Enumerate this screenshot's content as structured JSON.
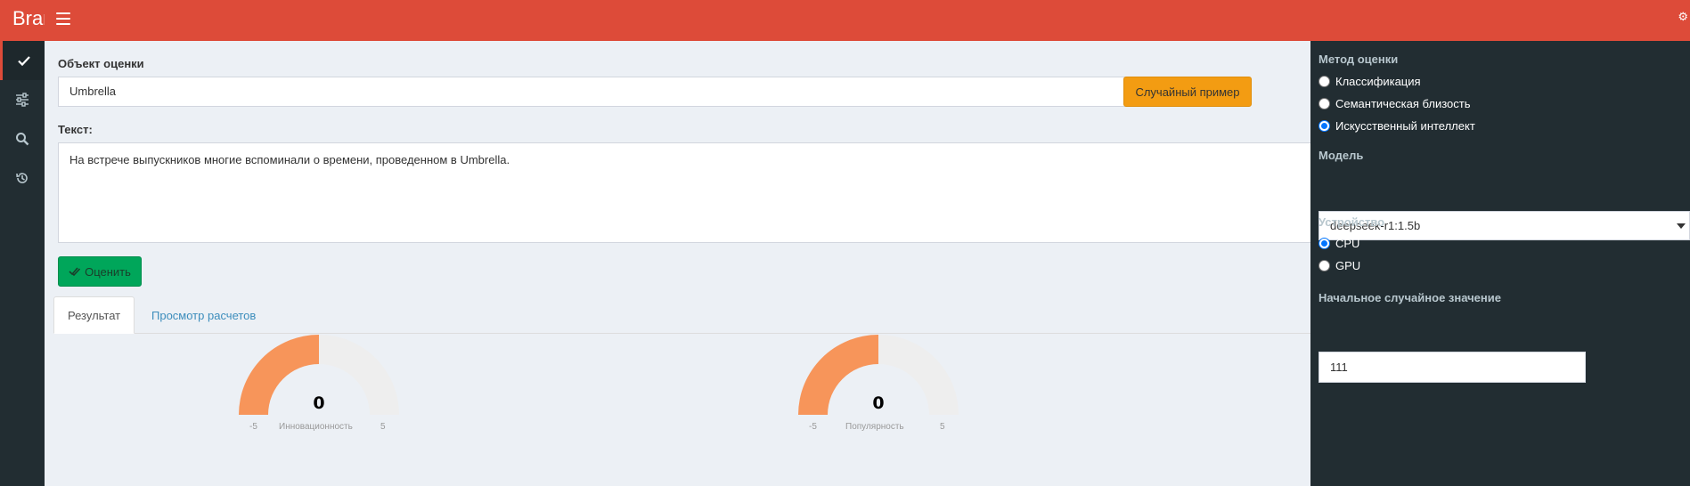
{
  "header": {
    "brand": "Brand",
    "menu_icon": "hamburger-icon",
    "settings_icon": "gear-icon"
  },
  "left_sidebar": {
    "items": [
      {
        "icon": "check-icon",
        "active": true
      },
      {
        "icon": "sliders-icon",
        "active": false
      },
      {
        "icon": "search-icon",
        "active": false
      },
      {
        "icon": "history-icon",
        "active": false
      }
    ]
  },
  "form": {
    "object_label": "Объект оценки",
    "object_value": "Umbrella",
    "random_button": "Случайный пример",
    "text_label": "Текст:",
    "text_value": "На встрече выпускников многие вспоминали о времени, проведенном в Umbrella.",
    "evaluate_button": "Оценить"
  },
  "tabs": [
    {
      "label": "Результат",
      "active": true
    },
    {
      "label": "Просмотр расчетов",
      "active": false
    }
  ],
  "gauges": [
    {
      "value": "0",
      "min": "-5",
      "max": "5",
      "name": "Инновационность",
      "level": 0
    },
    {
      "value": "0",
      "min": "-5",
      "max": "5",
      "name": "Популярность",
      "level": 0
    }
  ],
  "right_panel": {
    "method_label": "Метод оценки",
    "methods": [
      {
        "label": "Классификация",
        "checked": false
      },
      {
        "label": "Семантическая близость",
        "checked": false
      },
      {
        "label": "Искусственный интеллект",
        "checked": true
      }
    ],
    "model_label": "Модель",
    "model_value": "deepseek-r1:1.5b",
    "device_label": "Устройство",
    "devices": [
      {
        "label": "CPU",
        "checked": true
      },
      {
        "label": "GPU",
        "checked": false
      }
    ],
    "seed_label": "Начальное случайное значение",
    "seed_value": "111"
  },
  "colors": {
    "header": "#dd4b39",
    "sidebar": "#222d32",
    "gauge_fill": "#f7955a",
    "gauge_track": "#eeeeee",
    "random_button": "#f39c12",
    "evaluate_button": "#00a65a",
    "link": "#3c8dbc"
  }
}
